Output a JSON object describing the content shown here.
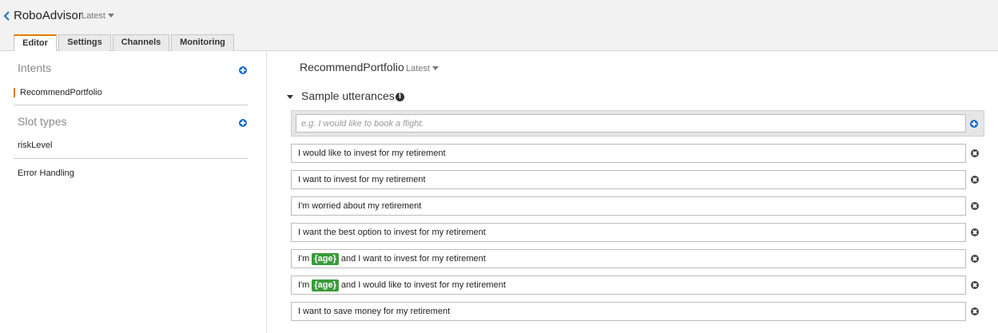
{
  "header": {
    "app_name": "RoboAdvisor",
    "version": "Latest",
    "tabs": [
      {
        "label": "Editor",
        "active": true
      },
      {
        "label": "Settings",
        "active": false
      },
      {
        "label": "Channels",
        "active": false
      },
      {
        "label": "Monitoring",
        "active": false
      }
    ]
  },
  "sidebar": {
    "intents_title": "Intents",
    "intents": [
      "RecommendPortfolio"
    ],
    "slot_types_title": "Slot types",
    "slot_types": [
      "riskLevel"
    ],
    "error_handling": "Error Handling"
  },
  "main": {
    "intent_name": "RecommendPortfolio",
    "intent_version": "Latest",
    "section_title": "Sample utterances",
    "info_icon": "i",
    "placeholder": "e.g. I would like to book a flight.",
    "utterances": [
      {
        "before": "I would like to invest for my retirement",
        "slot": "",
        "after": ""
      },
      {
        "before": "I want to invest for my retirement",
        "slot": "",
        "after": ""
      },
      {
        "before": "I'm worried about my retirement",
        "slot": "",
        "after": ""
      },
      {
        "before": "I want the best option to invest for my retirement",
        "slot": "",
        "after": ""
      },
      {
        "before": "I'm",
        "slot": "{age}",
        "after": "and I want to invest for my retirement"
      },
      {
        "before": "I'm",
        "slot": "{age}",
        "after": "and I would like to invest for my retirement"
      },
      {
        "before": "I want to save money for my retirement",
        "slot": "",
        "after": ""
      }
    ]
  },
  "icons": [
    "back-chevron-icon",
    "caret-down-icon",
    "plus-circle-icon",
    "info-icon",
    "remove-circle-icon",
    "collapse-triangle-icon"
  ],
  "colors": {
    "accent": "#e07b00",
    "add_blue": "#1a6fd0",
    "slot_green": "#3a9b3a"
  }
}
